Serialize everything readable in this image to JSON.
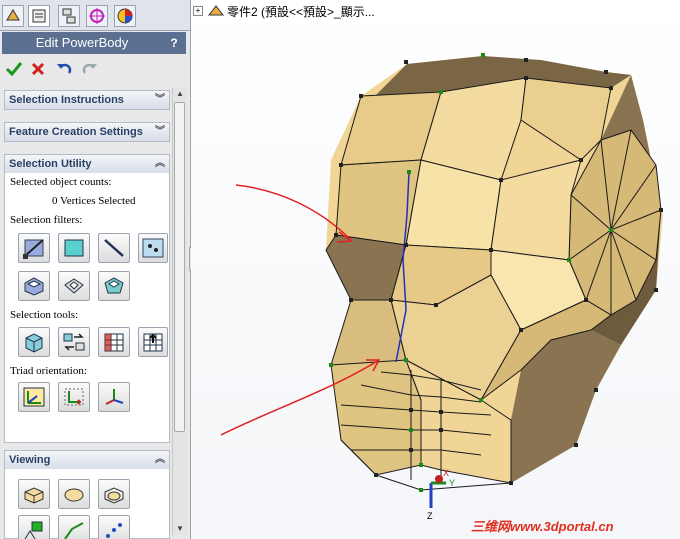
{
  "panel": {
    "tabs": [
      "feature-manager-icon",
      "property-manager-icon",
      "configuration-manager-icon",
      "dimxpert-icon",
      "appearance-icon"
    ],
    "title": "Edit PowerBody",
    "help": "?",
    "actions": [
      "ok-check-icon",
      "cancel-x-icon",
      "undo-icon",
      "redo-icon"
    ],
    "sections": {
      "selection_instructions": "Selection Instructions",
      "feature_creation_settings": "Feature Creation Settings",
      "selection_utility": "Selection Utility",
      "viewing": "Viewing"
    },
    "selection_utility": {
      "counts_label": "Selected object counts:",
      "vertices": "0 Vertices Selected",
      "filters_label": "Selection filters:",
      "tools_label": "Selection tools:",
      "triad_label": "Triad orientation:"
    }
  },
  "viewport": {
    "tree_text": "零件2 (預設<<預設>_顯示...",
    "watermark": "三维网www.3dportal.cn",
    "triad": {
      "x": "X",
      "y": "Y",
      "z": "Z"
    },
    "colors": {
      "face_light": "#f4dca0",
      "face_mid": "#d9bd7e",
      "face_dark": "#7a6545",
      "edge": "#1a1a1a",
      "highlight": "#2030c0",
      "annotation": "#e02020"
    }
  }
}
